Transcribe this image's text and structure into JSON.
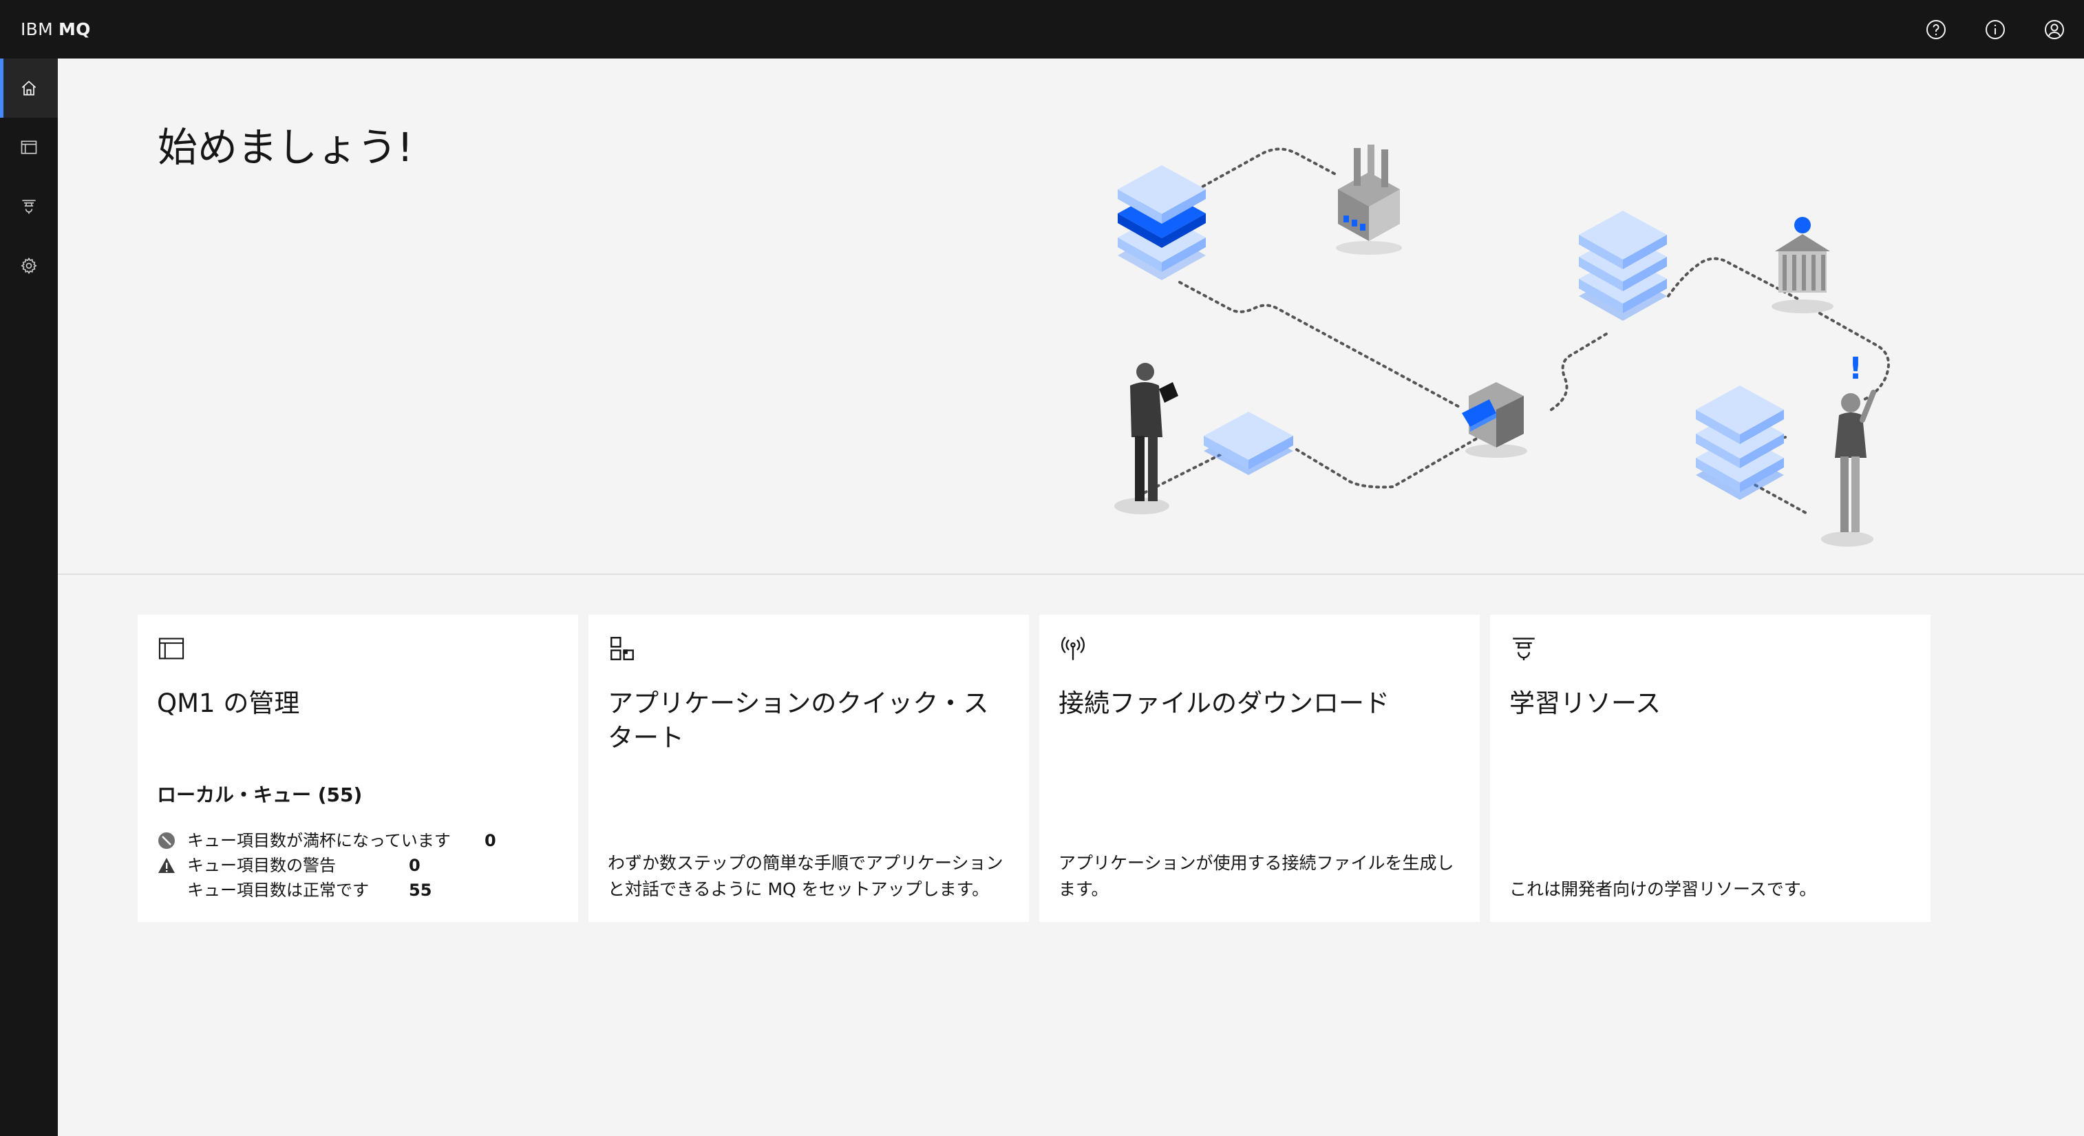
{
  "header": {
    "brand_light": "IBM",
    "brand_bold": "MQ",
    "icons": [
      "help-icon",
      "info-icon",
      "user-avatar-icon"
    ]
  },
  "siderail": {
    "items": [
      {
        "icon": "home-icon",
        "active": true
      },
      {
        "icon": "application-window-icon",
        "active": false
      },
      {
        "icon": "learning-icon",
        "active": false
      },
      {
        "icon": "settings-icon",
        "active": false
      }
    ]
  },
  "hero": {
    "title": "始めましょう!"
  },
  "tiles": {
    "manage": {
      "icon": "application-window-icon",
      "title": "QM1 の管理",
      "queue_heading": "ローカル・キュー (55)",
      "stats": [
        {
          "icon": "blocked-icon",
          "label": "キュー項目数が満杯になっています",
          "value": "0"
        },
        {
          "icon": "warning-icon",
          "label": "キュー項目数の警告",
          "value": "0"
        },
        {
          "icon": "",
          "label": "キュー項目数は正常です",
          "value": "55"
        }
      ]
    },
    "quickstart": {
      "icon": "apps-icon",
      "title": "アプリケーションのクイック・スタート",
      "description": "わずか数ステップの簡単な手順でアプリケーションと対話できるように MQ をセットアップします。"
    },
    "download": {
      "icon": "radio-tower-icon",
      "title": "接続ファイルのダウンロード",
      "description": "アプリケーションが使用する接続ファイルを生成します。"
    },
    "learning": {
      "icon": "learning-icon",
      "title": "学習リソース",
      "description": "これは開発者向けの学習リソースです。"
    }
  },
  "colors": {
    "header_bg": "#161616",
    "page_bg": "#f4f4f4",
    "accent": "#4589ff",
    "illustration_blue": "#0f62fe"
  }
}
